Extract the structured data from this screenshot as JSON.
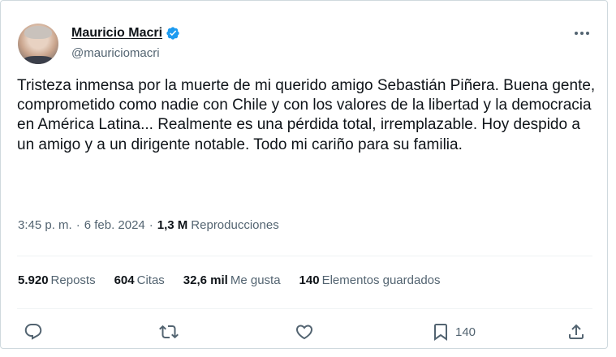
{
  "author": {
    "name": "Mauricio Macri",
    "handle": "@mauriciomacri"
  },
  "tweet": {
    "text": "Tristeza inmensa por la muerte de mi querido amigo Sebastián Piñera. Buena gente, comprometido como nadie con Chile y con los valores de la libertad y la democracia en América Latina... Realmente es una pérdida total, irremplazable. Hoy despido a un amigo y a un dirigente notable. Todo mi cariño para su familia."
  },
  "meta": {
    "time": "3:45 p. m.",
    "separator": "·",
    "date": "6 feb. 2024",
    "views_count": "1,3 M",
    "views_label": "Reproducciones"
  },
  "stats": {
    "reposts_count": "5.920",
    "reposts_label": "Reposts",
    "quotes_count": "604",
    "quotes_label": "Citas",
    "likes_count": "32,6 mil",
    "likes_label": "Me gusta",
    "bookmarks_count": "140",
    "bookmarks_label": "Elementos guardados"
  },
  "actions": {
    "bookmark_count": "140"
  },
  "colors": {
    "text": "#0f1419",
    "secondary": "#536471",
    "verified": "#1d9bf0",
    "border": "#cfd9de"
  },
  "icons": [
    "verified-badge-icon",
    "more-icon",
    "reply-icon",
    "repost-icon",
    "like-icon",
    "bookmark-icon",
    "share-icon"
  ]
}
